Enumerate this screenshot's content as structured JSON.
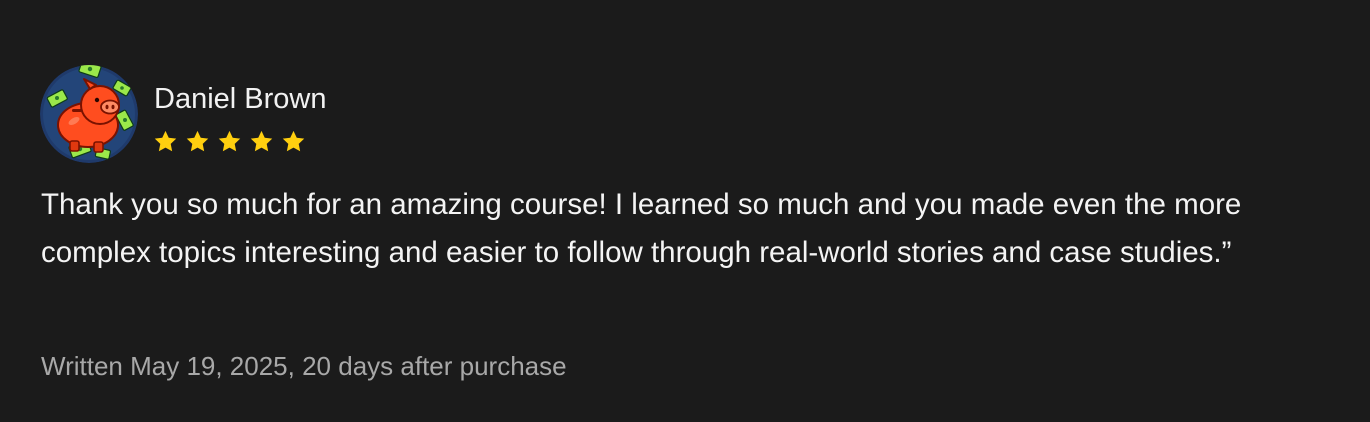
{
  "review": {
    "reviewer_name": "Daniel Brown",
    "rating": 5,
    "max_rating": 5,
    "star_color": "#ffcf0f",
    "text": "Thank you so much for an amazing course! I learned so much and you made even the more complex topics interesting and easier to follow through real-world stories and case studies.”",
    "meta": "Written May 19, 2025, 20 days after purchase",
    "avatar_icon": "piggy-bank-with-money-icon"
  }
}
